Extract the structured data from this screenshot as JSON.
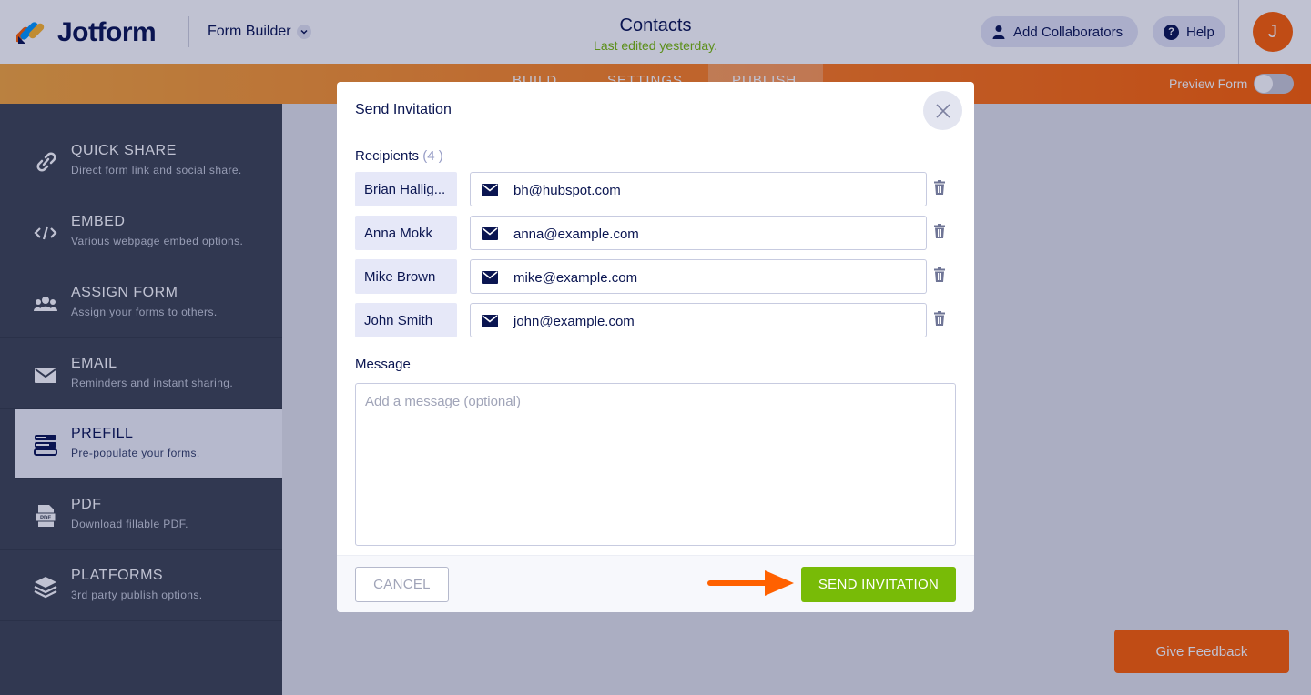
{
  "header": {
    "logo_text": "Jotform",
    "builder_label": "Form Builder",
    "form_title": "Contacts",
    "last_edited": "Last edited yesterday.",
    "add_collaborators_label": "Add Collaborators",
    "help_label": "Help",
    "help_glyph": "?",
    "avatar_initial": "J"
  },
  "tabs": {
    "build": "BUILD",
    "settings": "SETTINGS",
    "publish": "PUBLISH",
    "preview_label": "Preview Form"
  },
  "sidebar": {
    "items": [
      {
        "title": "QUICK SHARE",
        "desc": "Direct form link and social share.",
        "icon": "link-icon"
      },
      {
        "title": "EMBED",
        "desc": "Various webpage embed options.",
        "icon": "code-icon"
      },
      {
        "title": "ASSIGN FORM",
        "desc": "Assign your forms to others.",
        "icon": "users-icon"
      },
      {
        "title": "EMAIL",
        "desc": "Reminders and instant sharing.",
        "icon": "envelope-icon"
      },
      {
        "title": "PREFILL",
        "desc": "Pre-populate your forms.",
        "icon": "prefill-icon",
        "active": true
      },
      {
        "title": "PDF",
        "desc": "Download fillable PDF.",
        "icon": "pdf-icon"
      },
      {
        "title": "PLATFORMS",
        "desc": "3rd party publish options.",
        "icon": "layers-icon"
      }
    ]
  },
  "modal": {
    "title": "Send Invitation",
    "recipients_label": "Recipients",
    "recipients_count": "(4 )",
    "recipients": [
      {
        "name": "Brian Hallig...",
        "email": "bh@hubspot.com"
      },
      {
        "name": "Anna Mokk",
        "email": "anna@example.com"
      },
      {
        "name": "Mike Brown",
        "email": "mike@example.com"
      },
      {
        "name": "John Smith",
        "email": "john@example.com"
      }
    ],
    "message_label": "Message",
    "message_placeholder": "Add a message (optional)",
    "cancel_label": "CANCEL",
    "send_label": "SEND INVITATION"
  },
  "feedback": {
    "label": "Give Feedback"
  },
  "colors": {
    "brand_orange": "#ff6100",
    "send_green": "#78bb07",
    "navy": "#0a1551"
  }
}
